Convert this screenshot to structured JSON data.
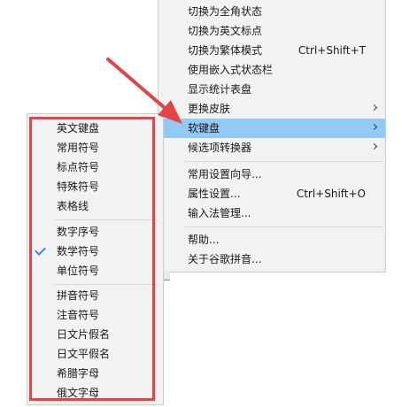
{
  "main_menu": {
    "items": [
      {
        "label": "切换为全角状态"
      },
      {
        "label": "切换为英文标点"
      },
      {
        "label": "切换为繁体模式",
        "shortcut": "Ctrl+Shift+T"
      },
      {
        "label": "使用嵌入式状态栏"
      },
      {
        "label": "显示统计表盘"
      },
      {
        "label": "更换皮肤"
      },
      {
        "label": "软键盘"
      },
      {
        "label": "候选项转换器"
      },
      {
        "label": "常用设置向导..."
      },
      {
        "label": "属性设置...",
        "shortcut": "Ctrl+Shift+O"
      },
      {
        "label": "输入法管理..."
      },
      {
        "label": "帮助..."
      },
      {
        "label": "关于谷歌拼音..."
      }
    ]
  },
  "soft_keyboard_submenu": {
    "items": [
      {
        "label": "英文键盘"
      },
      {
        "label": "常用符号"
      },
      {
        "label": "标点符号"
      },
      {
        "label": "特殊符号"
      },
      {
        "label": "表格线"
      },
      {
        "label": "数字序号"
      },
      {
        "label": "数学符号",
        "checked": true
      },
      {
        "label": "单位符号"
      },
      {
        "label": "拼音符号"
      },
      {
        "label": "注音符号"
      },
      {
        "label": "日文片假名"
      },
      {
        "label": "日文平假名"
      },
      {
        "label": "希腊字母"
      },
      {
        "label": "俄文字母"
      }
    ]
  },
  "colors": {
    "highlight": "#91c9f7",
    "annotation_red": "#e04646",
    "check_blue": "#3a8ee0"
  }
}
